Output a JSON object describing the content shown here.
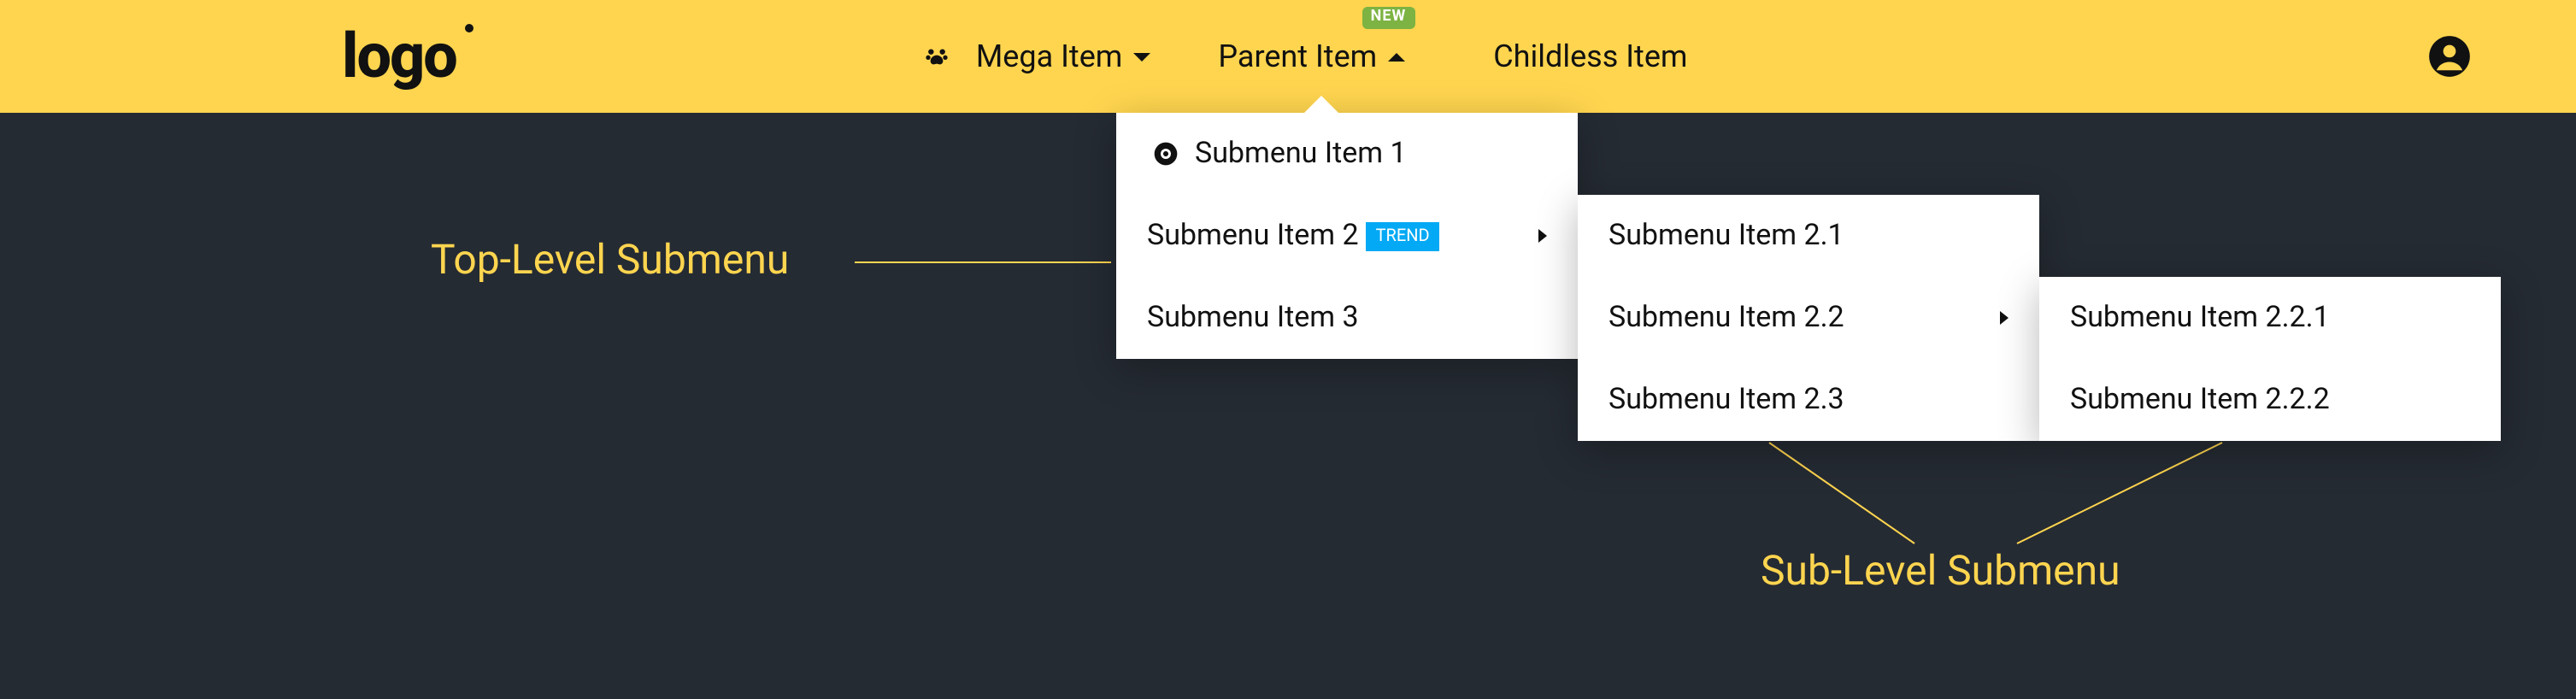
{
  "brand": {
    "text": "logo"
  },
  "nav": {
    "mega": {
      "label": "Mega Item"
    },
    "parent": {
      "label": "Parent Item",
      "badge": "NEW"
    },
    "childless": {
      "label": "Childless Item"
    }
  },
  "submenu": {
    "lvl1": {
      "item1": {
        "label": "Submenu Item 1"
      },
      "item2": {
        "label": "Submenu Item 2",
        "badge": "TREND"
      },
      "item3": {
        "label": "Submenu Item 3"
      }
    },
    "lvl2": {
      "item1": {
        "label": "Submenu Item 2.1"
      },
      "item2": {
        "label": "Submenu Item 2.2"
      },
      "item3": {
        "label": "Submenu Item 2.3"
      }
    },
    "lvl3": {
      "item1": {
        "label": "Submenu Item 2.2.1"
      },
      "item2": {
        "label": "Submenu Item 2.2.2"
      }
    }
  },
  "annotations": {
    "top": "Top-Level Submenu",
    "sub": "Sub-Level Submenu"
  }
}
